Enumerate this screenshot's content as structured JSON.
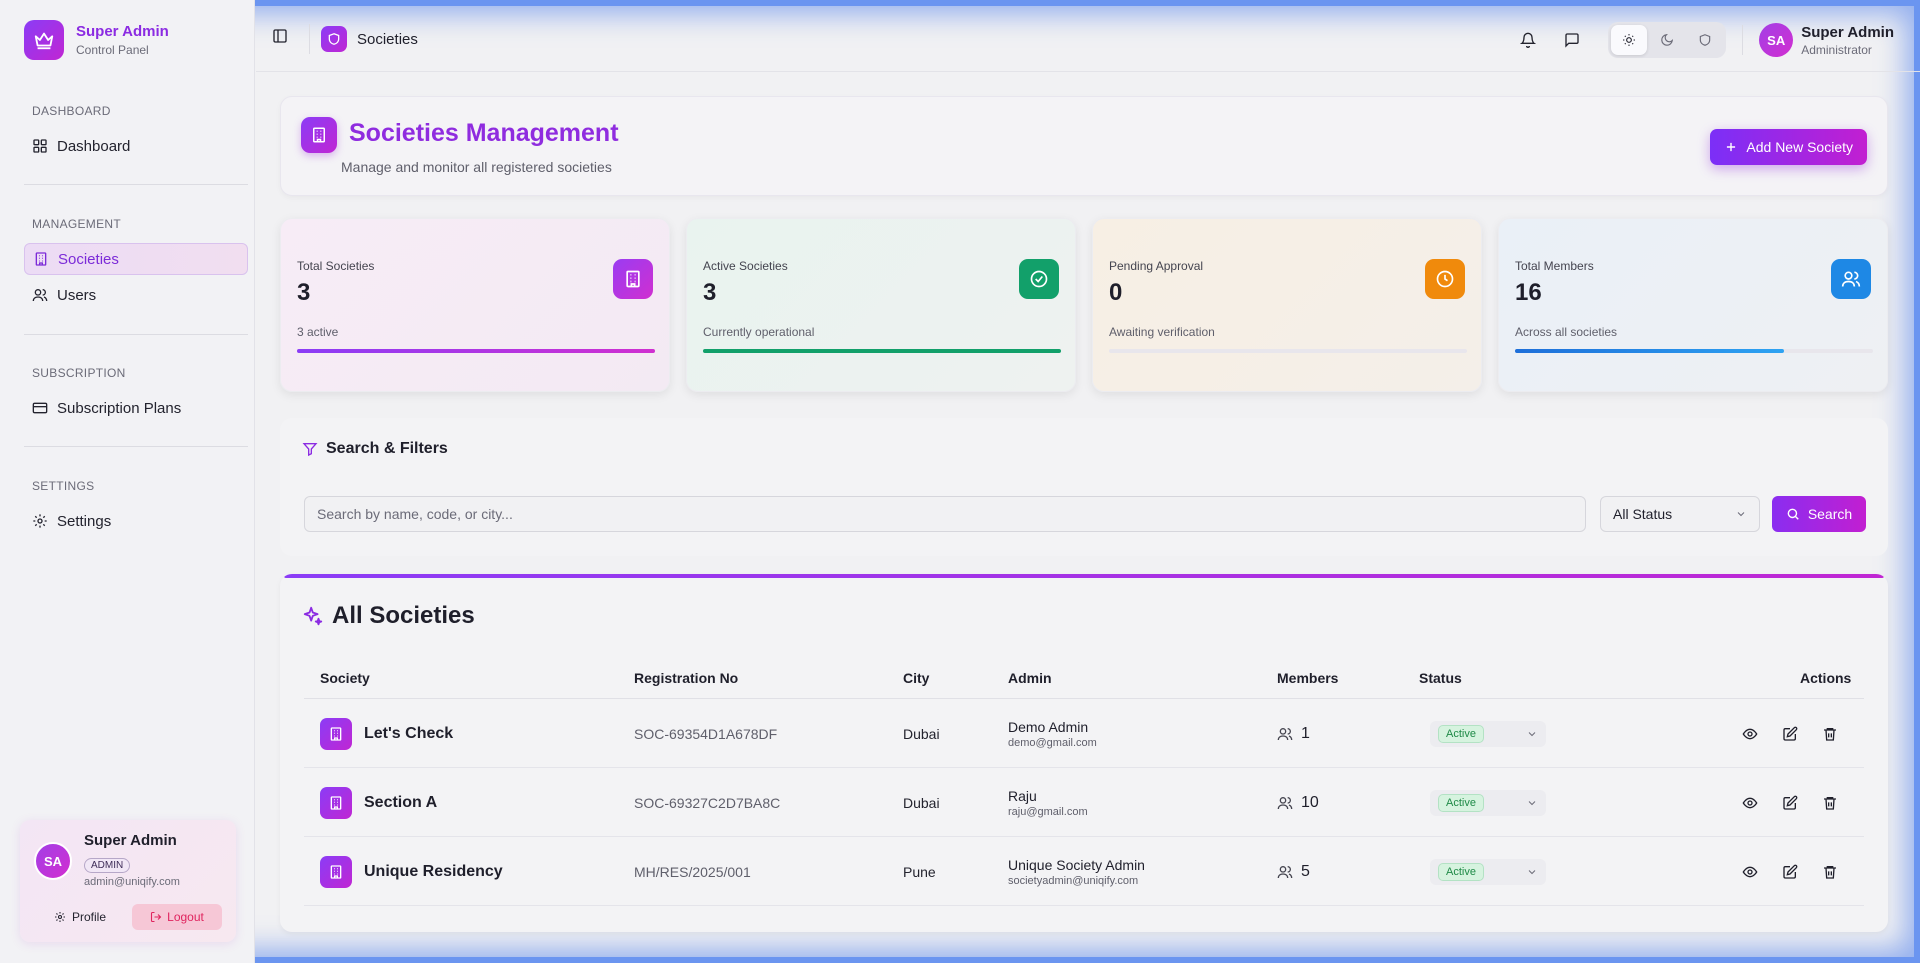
{
  "brand": {
    "title": "Super Admin",
    "subtitle": "Control Panel"
  },
  "sidebar": {
    "sections": [
      {
        "heading": "DASHBOARD",
        "items": [
          {
            "label": "Dashboard",
            "icon": "grid-icon"
          }
        ]
      },
      {
        "heading": "MANAGEMENT",
        "items": [
          {
            "label": "Societies",
            "icon": "building-icon",
            "active": true
          },
          {
            "label": "Users",
            "icon": "users-icon"
          }
        ]
      },
      {
        "heading": "SUBSCRIPTION",
        "items": [
          {
            "label": "Subscription Plans",
            "icon": "card-icon"
          }
        ]
      },
      {
        "heading": "SETTINGS",
        "items": [
          {
            "label": "Settings",
            "icon": "gear-icon"
          }
        ]
      }
    ],
    "user_card": {
      "initials": "SA",
      "name": "Super Admin",
      "badge": "ADMIN",
      "email": "admin@uniqify.com",
      "profile_label": "Profile",
      "logout_label": "Logout"
    }
  },
  "topbar": {
    "breadcrumb": "Societies",
    "user": {
      "initials": "SA",
      "name": "Super Admin",
      "role": "Administrator"
    }
  },
  "header": {
    "title": "Societies Management",
    "subtitle": "Manage and monitor all registered societies",
    "add_button": "Add New Society"
  },
  "stats": [
    {
      "label": "Total Societies",
      "value": "3",
      "note": "3 active",
      "progress": 1.0,
      "icon": "building-icon",
      "color": "#b536e0"
    },
    {
      "label": "Active Societies",
      "value": "3",
      "note": "Currently operational",
      "progress": 1.0,
      "icon": "check-circle-icon",
      "color": "#12a06a"
    },
    {
      "label": "Pending Approval",
      "value": "0",
      "note": "Awaiting verification",
      "progress": 0.0,
      "icon": "clock-icon",
      "color": "#f08a0c"
    },
    {
      "label": "Total Members",
      "value": "16",
      "note": "Across all societies",
      "progress": 0.75,
      "icon": "users-icon",
      "color": "#1e88e5"
    }
  ],
  "search": {
    "title": "Search & Filters",
    "placeholder": "Search by name, code, or city...",
    "status_value": "All Status",
    "button": "Search"
  },
  "table": {
    "title": "All Societies",
    "columns": [
      "Society",
      "Registration No",
      "City",
      "Admin",
      "Members",
      "Status",
      "Actions"
    ],
    "rows": [
      {
        "society": "Let's Check",
        "reg": "SOC-69354D1A678DF",
        "city": "Dubai",
        "admin_name": "Demo Admin",
        "admin_email": "demo@gmail.com",
        "members": "1",
        "status": "Active"
      },
      {
        "society": "Section A",
        "reg": "SOC-69327C2D7BA8C",
        "city": "Dubai",
        "admin_name": "Raju",
        "admin_email": "raju@gmail.com",
        "members": "10",
        "status": "Active"
      },
      {
        "society": "Unique Residency",
        "reg": "MH/RES/2025/001",
        "city": "Pune",
        "admin_name": "Unique Society Admin",
        "admin_email": "societyadmin@uniqify.com",
        "members": "5",
        "status": "Active"
      }
    ]
  },
  "colors": {
    "accent": "#8b2be2",
    "accent_gradient_end": "#c026d3",
    "active_status": "#1f8a47"
  }
}
